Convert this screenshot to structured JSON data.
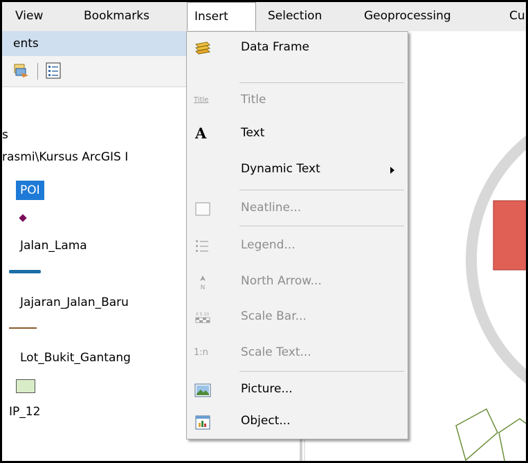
{
  "menubar": {
    "items": [
      "View",
      "Bookmarks",
      "Insert",
      "Selection",
      "Geoprocessing",
      "Cu"
    ]
  },
  "toc": {
    "title": "ents",
    "layers": [
      {
        "label": "s"
      },
      {
        "label": "rasmi\\Kursus ArcGIS I"
      },
      {
        "label": "POI"
      },
      {
        "label": "Jalan_Lama"
      },
      {
        "label": "Jajaran_Jalan_Baru"
      },
      {
        "label": "Lot_Bukit_Gantang"
      },
      {
        "label": "IP_12"
      }
    ]
  },
  "insert_menu": {
    "items": [
      {
        "label": "Data Frame",
        "enabled": true,
        "icon": "data-frame-icon"
      },
      {
        "label": "Title",
        "enabled": false,
        "icon": "title-icon"
      },
      {
        "label": "Text",
        "enabled": true,
        "icon": "text-icon"
      },
      {
        "label": "Dynamic Text",
        "enabled": true,
        "icon": "",
        "submenu": true
      },
      {
        "label": "Neatline...",
        "enabled": false,
        "icon": "neatline-icon"
      },
      {
        "label": "Legend...",
        "enabled": false,
        "icon": "legend-icon"
      },
      {
        "label": "North Arrow...",
        "enabled": false,
        "icon": "north-arrow-icon"
      },
      {
        "label": "Scale Bar...",
        "enabled": false,
        "icon": "scale-bar-icon"
      },
      {
        "label": "Scale Text...",
        "enabled": false,
        "icon": "scale-text-icon"
      },
      {
        "label": "Picture...",
        "enabled": true,
        "icon": "picture-icon"
      },
      {
        "label": "Object...",
        "enabled": true,
        "icon": "object-icon"
      }
    ],
    "icon_glyphs": {
      "title": "Title",
      "text": "A",
      "north": "N",
      "scale_ticks": "0 5 10",
      "scale_text": "1:n"
    }
  },
  "colors": {
    "selection": "#1e7ad6",
    "toc_title_bg": "#cfdff0",
    "poi_marker": "#7a0a5a",
    "jalan_lama_line": "#1b6ea8",
    "jajaran_line": "#8b5a2b",
    "lot_fill": "#d9ecc8",
    "map_red": "#e06055"
  }
}
